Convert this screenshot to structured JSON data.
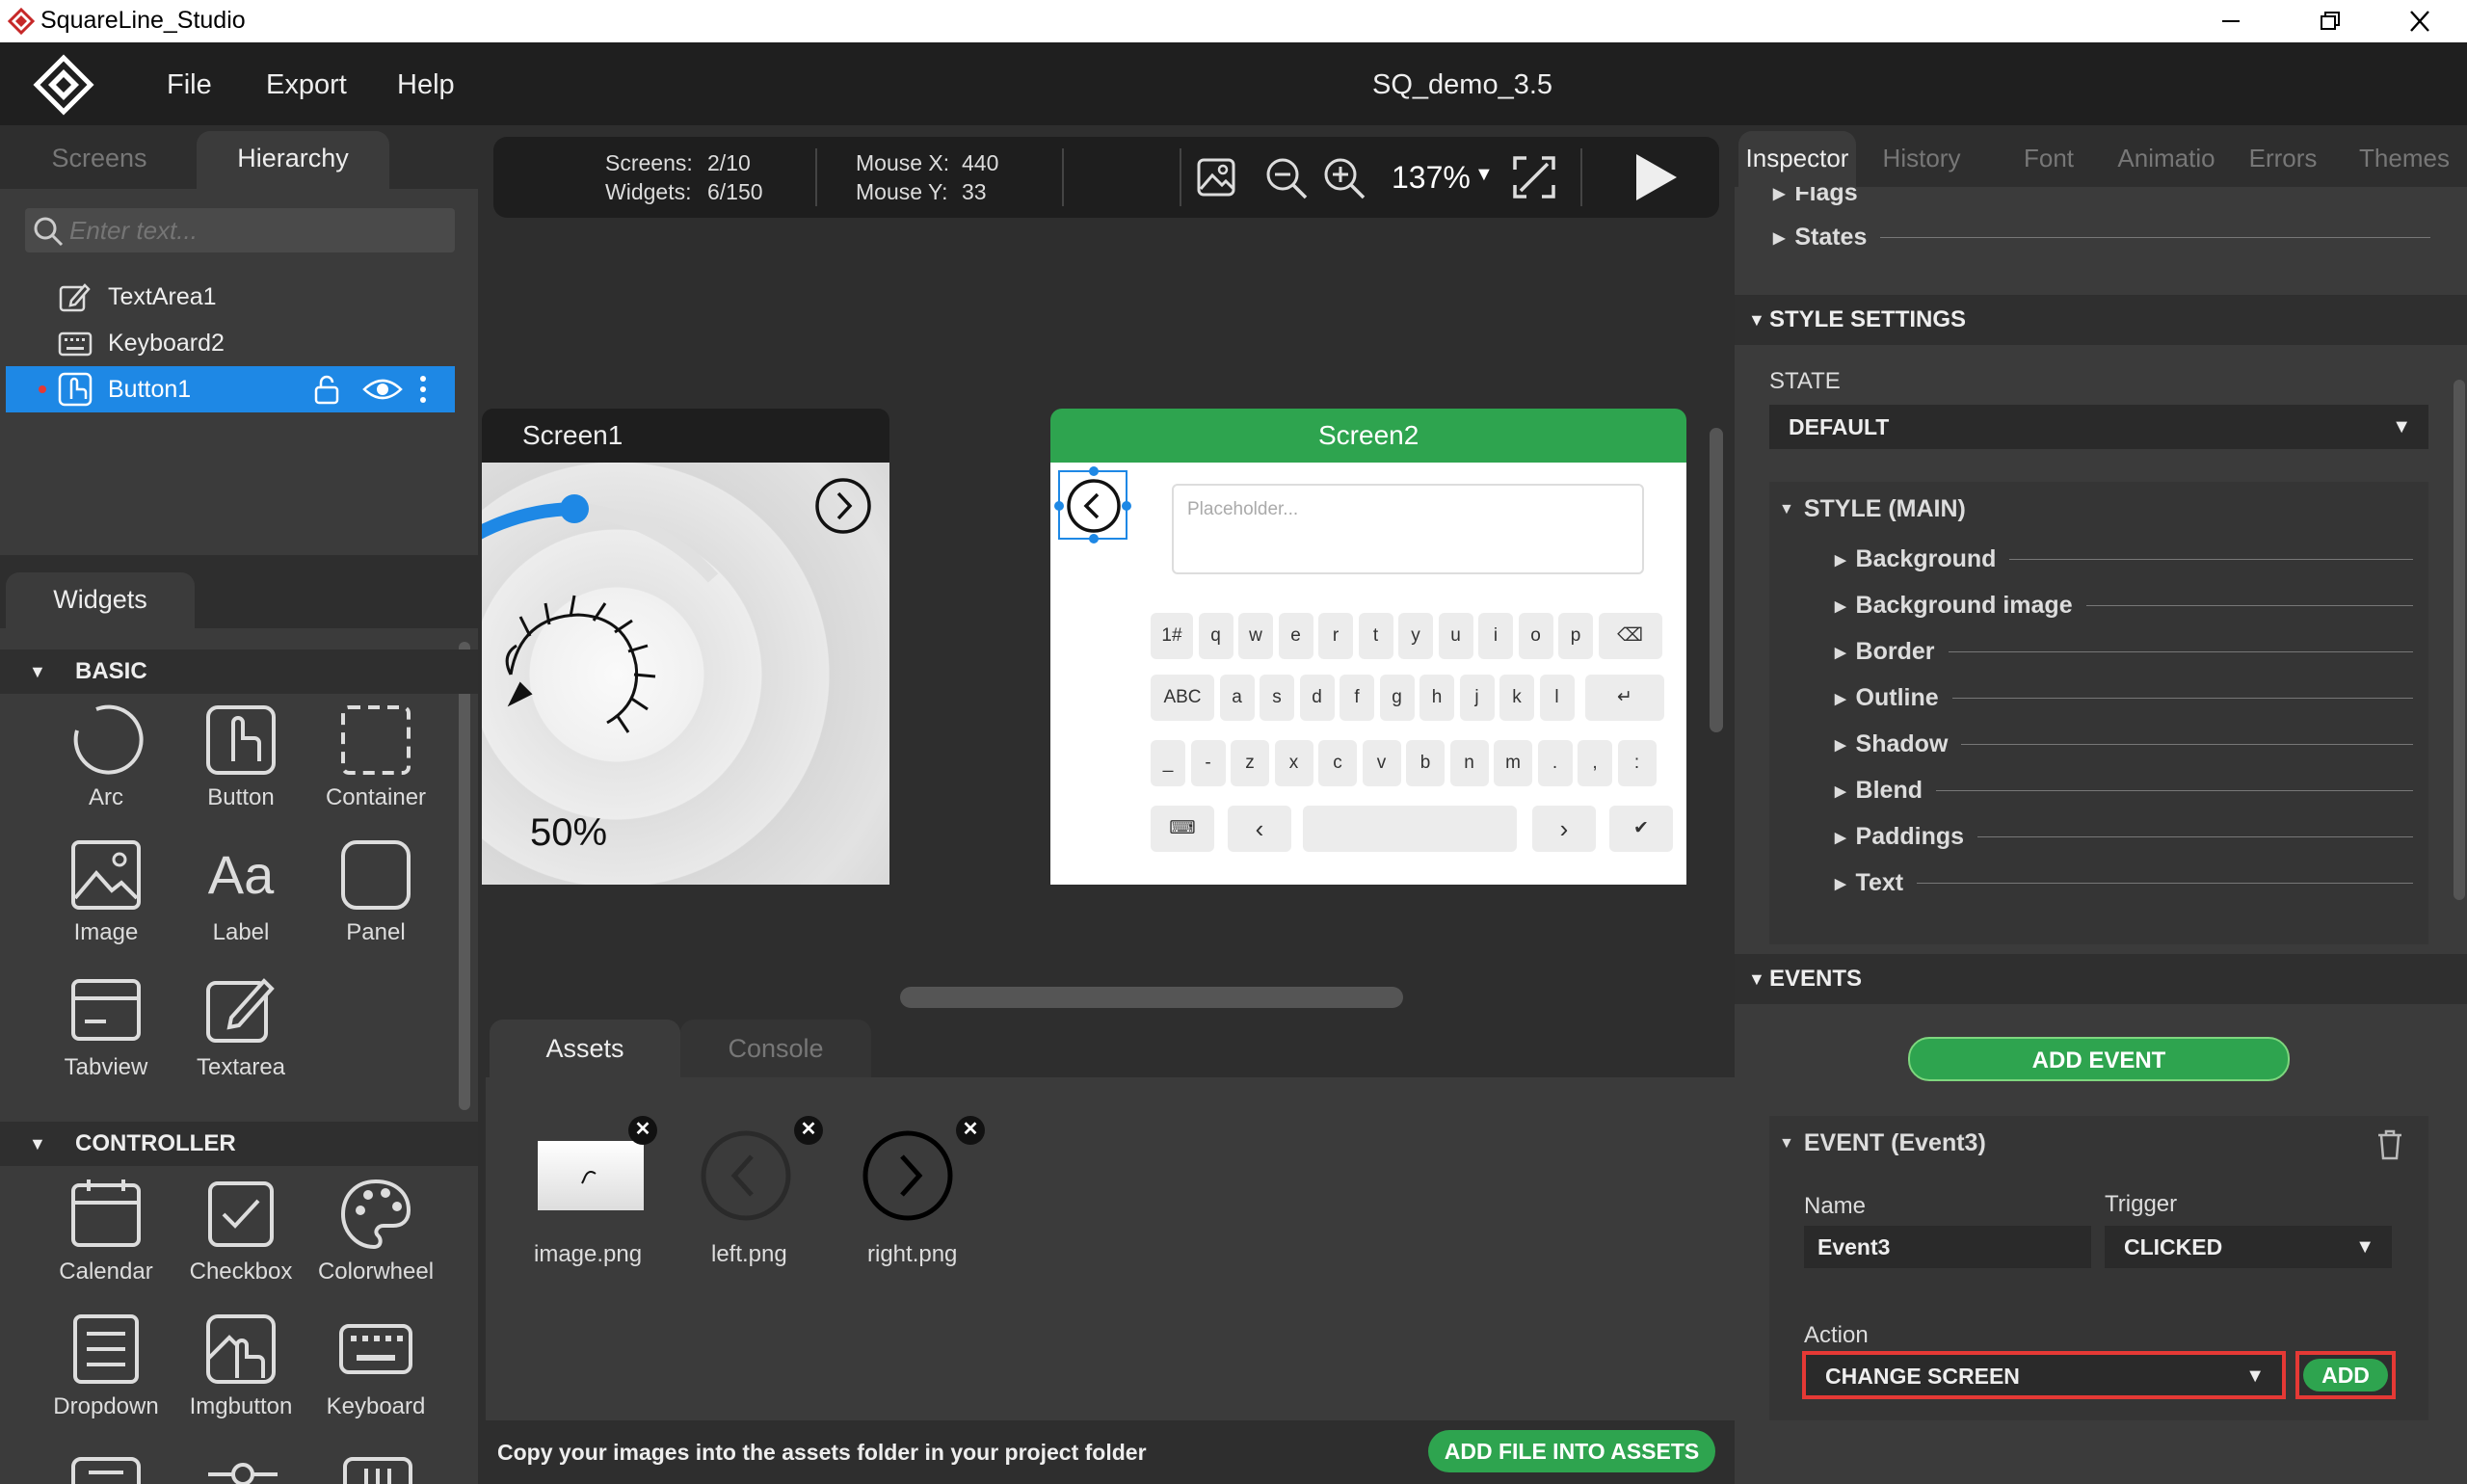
{
  "window": {
    "title": "SquareLine_Studio",
    "project": "SQ_demo_3.5"
  },
  "menu": {
    "file": "File",
    "export": "Export",
    "help": "Help"
  },
  "left_tabs": {
    "screens": "Screens",
    "hierarchy": "Hierarchy"
  },
  "search": {
    "placeholder": "Enter text..."
  },
  "hierarchy": [
    {
      "label": "TextArea1",
      "icon": "textarea-icon"
    },
    {
      "label": "Keyboard2",
      "icon": "keyboard-icon"
    },
    {
      "label": "Button1",
      "icon": "button-icon"
    }
  ],
  "widgets_tab": "Widgets",
  "widget_sections": {
    "basic": "BASIC",
    "controller": "CONTROLLER"
  },
  "basic_widgets": [
    "Arc",
    "Button",
    "Container",
    "Image",
    "Label",
    "Panel",
    "Tabview",
    "Textarea"
  ],
  "controller_widgets": [
    "Calendar",
    "Checkbox",
    "Colorwheel",
    "Dropdown",
    "Imgbutton",
    "Keyboard"
  ],
  "toolbar": {
    "screens_label": "Screens:",
    "screens_value": "2/10",
    "widgets_label": "Widgets:",
    "widgets_value": "6/150",
    "mouse_x_label": "Mouse X:",
    "mouse_x_value": "440",
    "mouse_y_label": "Mouse Y:",
    "mouse_y_value": "33",
    "zoom": "137%"
  },
  "canvas": {
    "screen1_title": "Screen1",
    "screen2_title": "Screen2",
    "progress_text": "50%",
    "textarea_placeholder": "Placeholder...",
    "arc_percent": 50
  },
  "keyboard": {
    "row1": [
      "1#",
      "q",
      "w",
      "e",
      "r",
      "t",
      "y",
      "u",
      "i",
      "o",
      "p"
    ],
    "row2": [
      "ABC",
      "a",
      "s",
      "d",
      "f",
      "g",
      "h",
      "j",
      "k",
      "l"
    ],
    "row3": [
      "_",
      "-",
      "z",
      "x",
      "c",
      "v",
      "b",
      "n",
      "m",
      ".",
      ",",
      ":"
    ]
  },
  "bottom_tabs": {
    "assets": "Assets",
    "console": "Console"
  },
  "assets": [
    {
      "name": "image.png"
    },
    {
      "name": "left.png"
    },
    {
      "name": "right.png"
    }
  ],
  "assets_footer": {
    "hint": "Copy your images into the assets folder in your project folder",
    "add_button": "ADD FILE INTO ASSETS"
  },
  "inspector_tabs": [
    "Inspector",
    "History",
    "Font",
    "Animatio",
    "Errors",
    "Themes"
  ],
  "inspector": {
    "flags": "Flags",
    "states": "States",
    "style_settings": "STYLE SETTINGS",
    "state_label": "STATE",
    "state_value": "DEFAULT",
    "style_main": "STYLE (MAIN)",
    "style_props": [
      "Background",
      "Background image",
      "Border",
      "Outline",
      "Shadow",
      "Blend",
      "Paddings",
      "Text"
    ],
    "events": "EVENTS",
    "add_event": "ADD EVENT",
    "event_title": "EVENT (Event3)",
    "name_label": "Name",
    "name_value": "Event3",
    "trigger_label": "Trigger",
    "trigger_value": "CLICKED",
    "action_label": "Action",
    "action_value": "CHANGE SCREEN",
    "add_button": "ADD"
  },
  "colors": {
    "accent_green": "#2ea44f",
    "selection_blue": "#1e88e5",
    "highlight_red": "#e53935"
  }
}
